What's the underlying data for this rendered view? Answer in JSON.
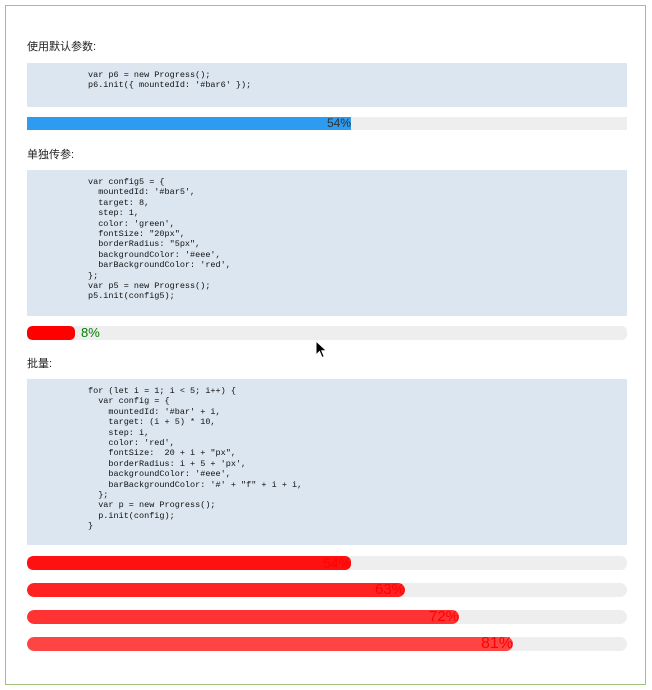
{
  "sections": {
    "default": {
      "heading": "使用默认参数:",
      "code": "var p6 = new Progress();\np6.init({ mountedId: '#bar6' });"
    },
    "single": {
      "heading": "单独传参:",
      "code": "var config5 = {\n  mountedId: '#bar5',\n  target: 8,\n  step: 1,\n  color: 'green',\n  fontSize: \"20px\",\n  borderRadius: \"5px\",\n  backgroundColor: '#eee',\n  barBackgroundColor: 'red',\n};\nvar p5 = new Progress();\np5.init(config5);"
    },
    "batch": {
      "heading": "批量:",
      "code": "for (let i = 1; i < 5; i++) {\n  var config = {\n    mountedId: '#bar' + i,\n    target: (i + 5) * 10,\n    step: i,\n    color: 'red',\n    fontSize:  20 + i + \"px\",\n    borderRadius: i + 5 + 'px',\n    backgroundColor: '#eee',\n    barBackgroundColor: '#' + \"f\" + i + i,\n  };\n  var p = new Progress();\n  p.init(config);\n}"
    }
  },
  "bars": {
    "bar6": {
      "label": "54%",
      "value": 0.54,
      "fill": "#2d9bf0",
      "track": "#eeeeee",
      "text": "#333333"
    },
    "bar5": {
      "label": "8%",
      "value": 0.08,
      "fill": "#ff0000",
      "track": "#eeeeee",
      "text": "#008000"
    },
    "bar1": {
      "label": "54%",
      "value": 0.54,
      "fill": "#ff1111",
      "track": "#eeeeee",
      "text": "#ff0000"
    },
    "bar2": {
      "label": "63%",
      "value": 0.63,
      "fill": "#ff2222",
      "track": "#eeeeee",
      "text": "#ff0000"
    },
    "bar3": {
      "label": "72%",
      "value": 0.72,
      "fill": "#ff3333",
      "track": "#eeeeee",
      "text": "#ff0000"
    },
    "bar4": {
      "label": "81%",
      "value": 0.81,
      "fill": "#ff4444",
      "track": "#eeeeee",
      "text": "#ff0000"
    }
  }
}
